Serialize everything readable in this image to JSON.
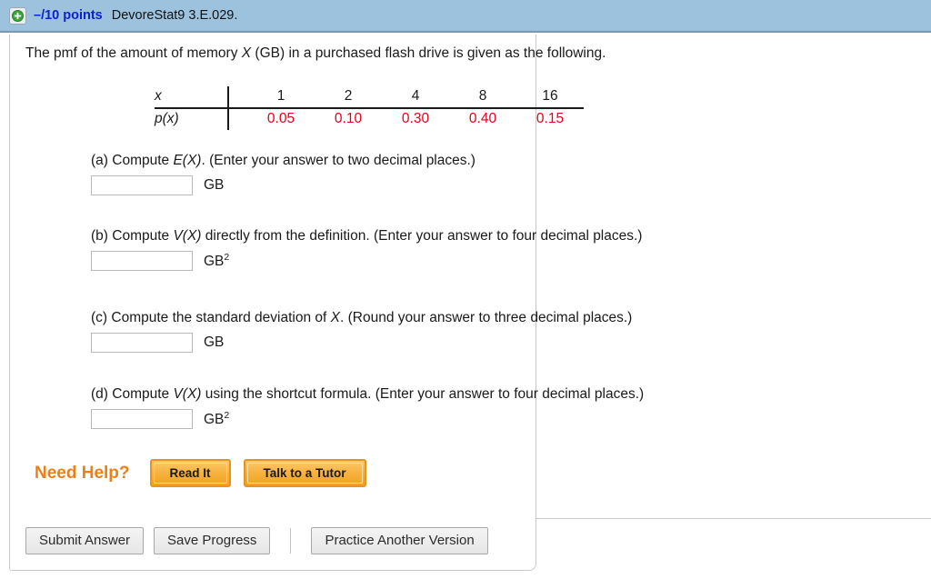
{
  "header": {
    "expand_icon": "plus-circle-icon",
    "points": "–/10 points",
    "assignment_id": "DevoreStat9 3.E.029.",
    "bar_color": "#9dc2de",
    "points_color": "#0c22cc"
  },
  "problem": {
    "intro_part1": "The pmf of the amount of memory ",
    "intro_var": "X",
    "intro_part2": " (GB) in a purchased flash drive is given as the following."
  },
  "pmf_table": {
    "row_label_x": "x",
    "row_label_px": "p(x)",
    "x_values": [
      "1",
      "2",
      "4",
      "8",
      "16"
    ],
    "p_values": [
      "0.05",
      "0.10",
      "0.30",
      "0.40",
      "0.15"
    ],
    "prob_color": "#e7001b"
  },
  "questions": [
    {
      "label": "(a) Compute ",
      "expr": "E(X)",
      "label_tail": ". (Enter your answer to two decimal places.)",
      "value": "",
      "unit": "GB",
      "unit_sup": ""
    },
    {
      "label": "(b) Compute ",
      "expr": "V(X)",
      "label_tail": " directly from the definition. (Enter your answer to four decimal places.)",
      "value": "",
      "unit": "GB",
      "unit_sup": "2"
    },
    {
      "label": "(c) Compute the standard deviation of ",
      "expr": "X",
      "label_tail": ". (Round your answer to three decimal places.)",
      "value": "",
      "unit": "GB",
      "unit_sup": ""
    },
    {
      "label": "(d) Compute ",
      "expr": "V(X)",
      "label_tail": " using the shortcut formula. (Enter your answer to four decimal places.)",
      "value": "",
      "unit": "GB",
      "unit_sup": "2"
    }
  ],
  "need_help": {
    "label": "Need Help?",
    "label_color": "#eb8019",
    "read_it": "Read It",
    "talk_to_tutor": "Talk to a Tutor"
  },
  "actions": {
    "submit": "Submit Answer",
    "save": "Save Progress",
    "practice": "Practice Another Version"
  }
}
